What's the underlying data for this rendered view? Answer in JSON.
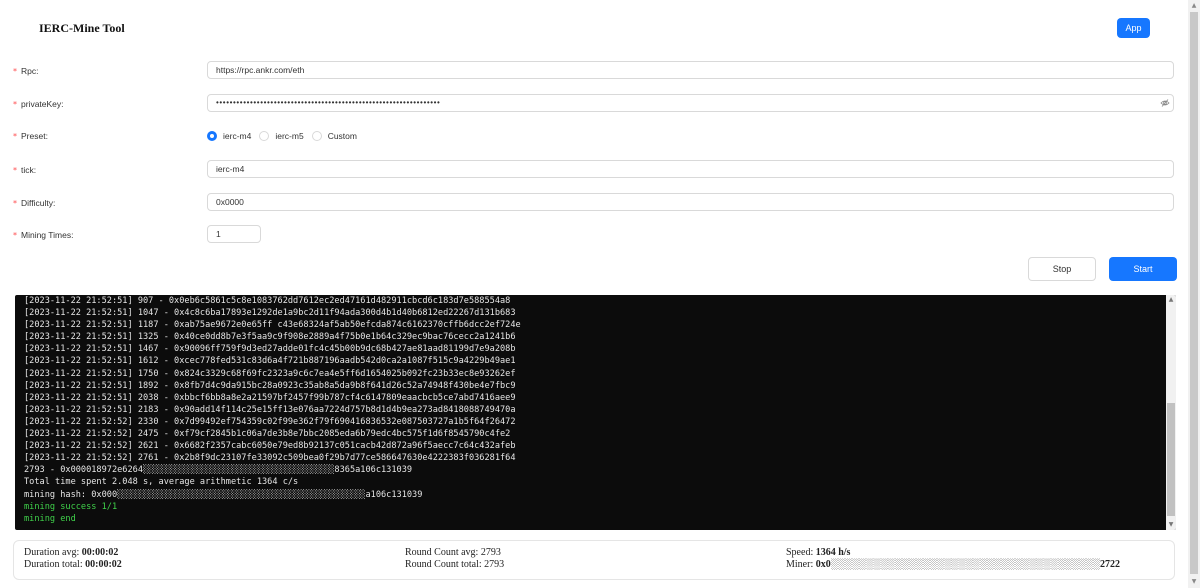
{
  "header": {
    "title": "IERC-Mine Tool",
    "app_button": "App"
  },
  "form": {
    "required_mark": "*",
    "rpc": {
      "label": "Rpc:",
      "value": "https://rpc.ankr.com/eth"
    },
    "private_key": {
      "label": "privateKey:",
      "value": "••••••••••••••••••••••••••••••••••••••••••••••••••••••••••••••••••"
    },
    "preset": {
      "label": "Preset:",
      "options": [
        "ierc-m4",
        "ierc-m5",
        "Custom"
      ],
      "selected": "ierc-m4"
    },
    "tick": {
      "label": "tick:",
      "value": "ierc-m4"
    },
    "difficulty": {
      "label": "Difficulty:",
      "value": "0x0000"
    },
    "mining_times": {
      "label": "Mining Times:",
      "value": "1"
    }
  },
  "actions": {
    "stop": "Stop",
    "start": "Start"
  },
  "console": {
    "lines": [
      "[2023-11-22 21:52:51] 907 - 0x0eb6c5861c5c8e1083762dd7612ec2ed47161d482911cbcd6c183d7e588554a8",
      "[2023-11-22 21:52:51] 1047 - 0x4c8c6ba17893e1292de1a9bc2d11f94ada300d4b1d40b6812ed22267d131b683",
      "[2023-11-22 21:52:51] 1187 - 0xab75ae9672e0e65ff c43e68324af5ab50efcda874c6162370cffb6dcc2ef724e",
      "[2023-11-22 21:52:51] 1325 - 0x40ce0dd8b7e3f5aa9c9f908e2889a4f75b0e1b64c329ec9bac76cecc2a1241b6",
      "[2023-11-22 21:52:51] 1467 - 0x90096ff759f9d3ed27adde01fc4c45b00b9dc68b427ae81aad81199d7e9a208b",
      "[2023-11-22 21:52:51] 1612 - 0xcec778fed531c83d6a4f721b887196aadb542d0ca2a1087f515c9a4229b49ae1",
      "[2023-11-22 21:52:51] 1750 - 0x824c3329c68f69fc2323a9c6c7ea4e5ff6d1654025b092fc23b33ec8e93262ef",
      "[2023-11-22 21:52:51] 1892 - 0x8fb7d4c9da915bc28a0923c35ab8a5da9b8f641d26c52a74948f430be4e7fbc9",
      "[2023-11-22 21:52:51] 2038 - 0xbbcf6bb8a8e2a21597bf2457f99b787cf4c6147809eaacbcb5ce7abd7416aee9",
      "[2023-11-22 21:52:51] 2183 - 0x90add14f114c25e15ff13e076aa7224d757b8d1d4b9ea273ad8418088749470a",
      "[2023-11-22 21:52:52] 2330 - 0x7d99492ef754359c02f99e362f79f690416836532e087503727a1b5f64f26472",
      "[2023-11-22 21:52:52] 2475 - 0xf79cf2845b1c06a7de3b8e7bbc2085eda6b79edc4bc575f1d6f8545790c4fe2",
      "[2023-11-22 21:52:52] 2621 - 0x6682f2357cabc6050e79ed8b92137c051cacb42d872a96f5aecc7c64c432afeb",
      "[2023-11-22 21:52:52] 2761 - 0x2b8f9dc23107fe33092c509bea0f29b7d77ce586647630e4222383f036281f64",
      "2793 - 0x000018972e6264░░░░░░░░░░░░░░░░░░░░░░░░░░░░░░░░░░░░░8365a106c131039",
      "Total time spent 2.048 s, average arithmetic 1364 c/s",
      "mining hash: 0x000░░░░░░░░░░░░░░░░░░░░░░░░░░░░░░░░░░░░░░░░░░░░░░░░a106c131039"
    ],
    "success_lines": [
      "mining success 1/1",
      "mining end"
    ]
  },
  "stats": {
    "duration_avg_label": "Duration avg:",
    "duration_avg_value": "00:00:02",
    "duration_total_label": "Duration total:",
    "duration_total_value": "00:00:02",
    "round_avg_label": "Round Count avg:",
    "round_avg_value": "2793",
    "round_total_label": "Round Count total:",
    "round_total_value": "2793",
    "speed_label": "Speed:",
    "speed_value": "1364 h/s",
    "miner_label": "Miner:",
    "miner_value": "0x0░░░░░░░░░░░░░░░░░░░░░░░░░░░░░░░░░░░░░░2722"
  },
  "colors": {
    "primary": "#1677ff",
    "required": "#ff4d4f",
    "console_bg": "#0c0c0c",
    "console_text": "#e6e6e6",
    "console_success": "#3fd14a"
  }
}
